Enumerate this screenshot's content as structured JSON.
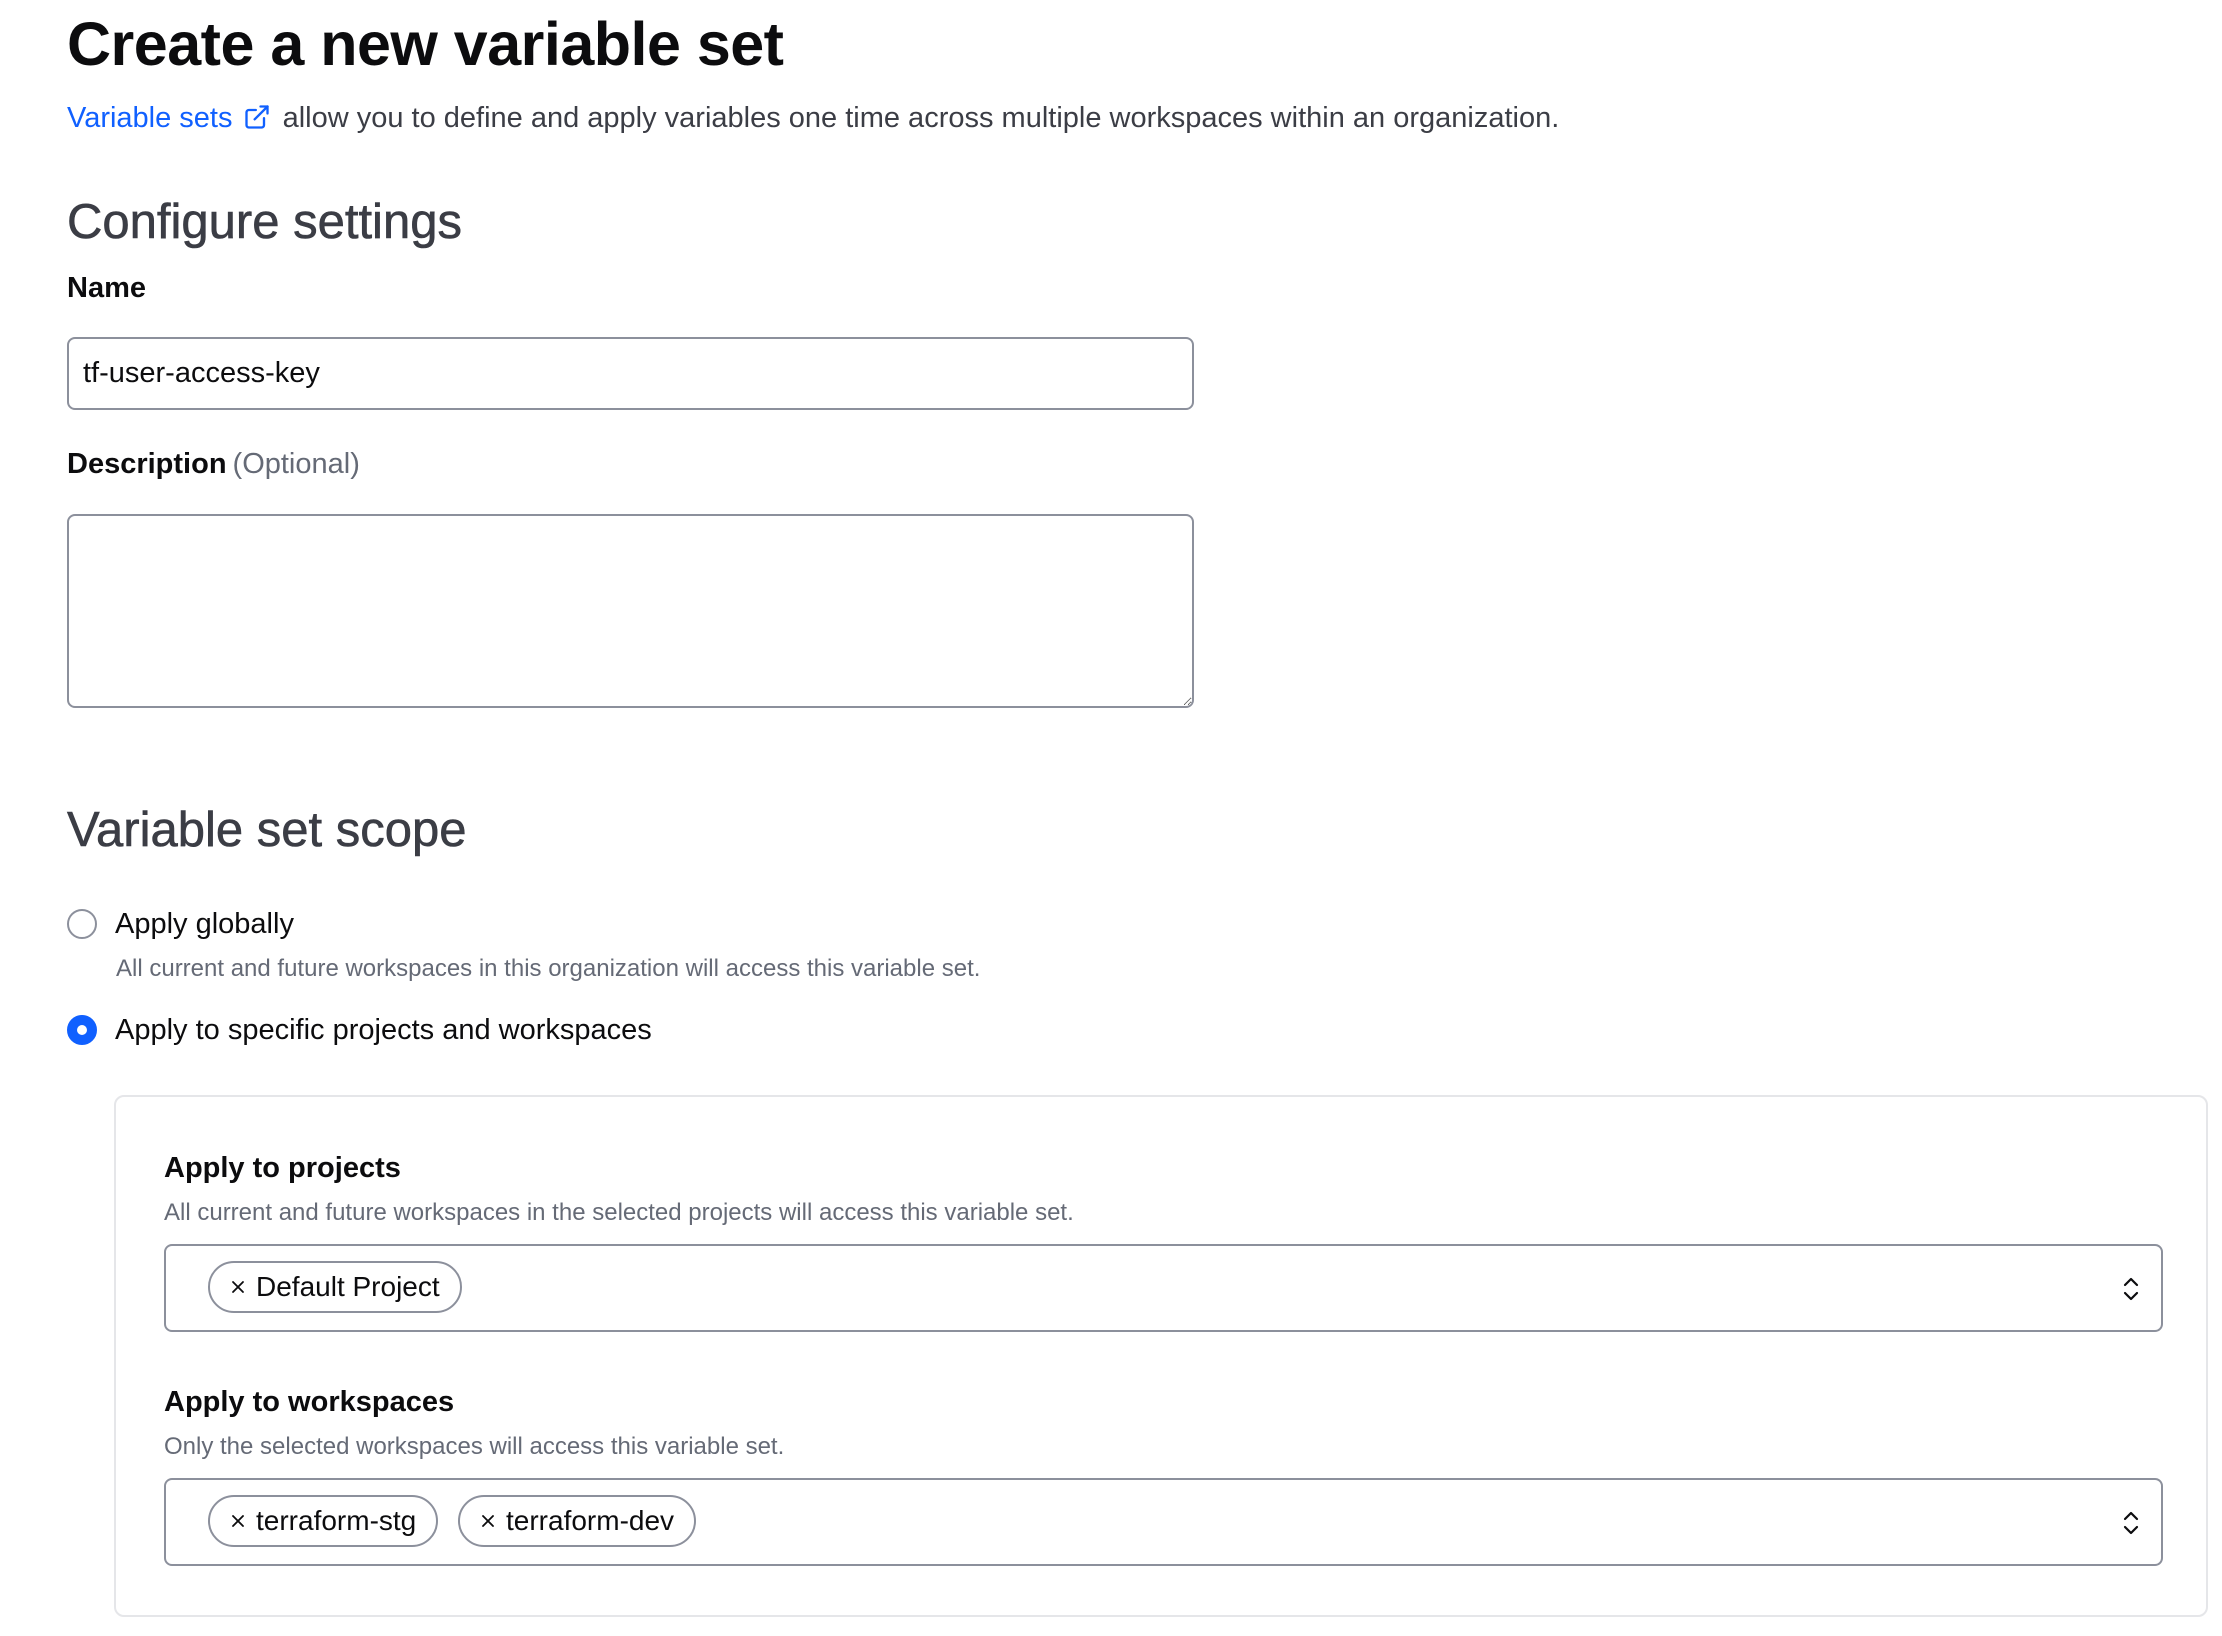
{
  "page": {
    "title": "Create a new variable set",
    "intro_link": "Variable sets",
    "intro_text": "allow you to define and apply variables one time across multiple workspaces within an organization."
  },
  "configure": {
    "heading": "Configure settings",
    "name_label": "Name",
    "name_value": "tf-user-access-key",
    "description_label": "Description",
    "description_optional": "(Optional)",
    "description_value": ""
  },
  "scope": {
    "heading": "Variable set scope",
    "options": [
      {
        "label": "Apply globally",
        "help": "All current and future workspaces in this organization will access this variable set.",
        "selected": false
      },
      {
        "label": "Apply to specific projects and workspaces",
        "selected": true
      }
    ],
    "projects": {
      "label": "Apply to projects",
      "help": "All current and future workspaces in the selected projects will access this variable set.",
      "chips": [
        "Default Project"
      ]
    },
    "workspaces": {
      "label": "Apply to workspaces",
      "help": "Only the selected workspaces will access this variable set.",
      "chips": [
        "terraform-stg",
        "terraform-dev"
      ]
    }
  },
  "colors": {
    "accent": "#1060ff",
    "text": "#0c0c0e",
    "muted": "#656a76",
    "border": "#8c909c"
  },
  "icons": {
    "external_link": "external-link-icon",
    "remove_chip": "close-icon",
    "select_chevron": "chevron-up-down-icon"
  }
}
